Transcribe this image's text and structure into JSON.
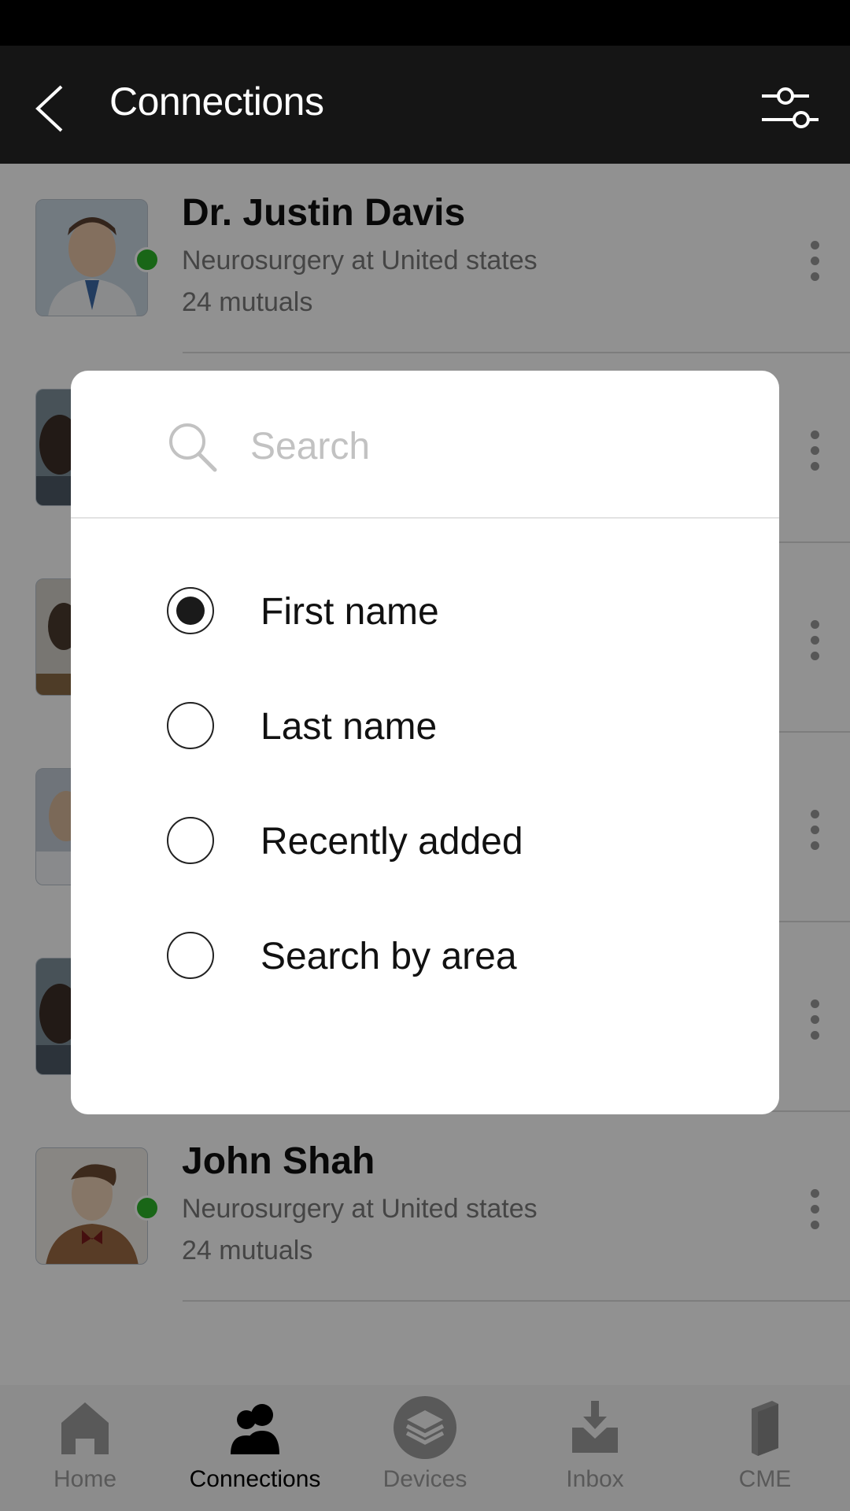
{
  "header": {
    "title": "Connections"
  },
  "contacts": [
    {
      "name": "Dr. Justin Davis",
      "subtitle": "Neurosurgery at United states",
      "mutuals": "24 mutuals",
      "online": true,
      "avatar_color": "#9bb3c7"
    },
    {
      "name": "",
      "subtitle": "",
      "mutuals": "",
      "online": false,
      "avatar_color": "#5c6c78"
    },
    {
      "name": "",
      "subtitle": "",
      "mutuals": "",
      "online": false,
      "avatar_color": "#8c8478"
    },
    {
      "name": "",
      "subtitle": "",
      "mutuals": "",
      "online": false,
      "avatar_color": "#98a7b6"
    },
    {
      "name": "",
      "subtitle": "",
      "mutuals": "",
      "online": false,
      "avatar_color": "#5e6c77"
    },
    {
      "name": "John Shah",
      "subtitle": "Neurosurgery at United states",
      "mutuals": "24 mutuals",
      "online": true,
      "avatar_color": "#b9a48c"
    }
  ],
  "sort_dialog": {
    "search_placeholder": "Search",
    "options": [
      {
        "label": "First name",
        "selected": true
      },
      {
        "label": "Last name",
        "selected": false
      },
      {
        "label": "Recently added",
        "selected": false
      },
      {
        "label": "Search by area",
        "selected": false
      }
    ]
  },
  "bottom_nav": {
    "items": [
      {
        "label": "Home",
        "icon": "home-icon",
        "active": false
      },
      {
        "label": "Connections",
        "icon": "connections-icon",
        "active": true
      },
      {
        "label": "Devices",
        "icon": "devices-icon",
        "active": false
      },
      {
        "label": "Inbox",
        "icon": "inbox-icon",
        "active": false
      },
      {
        "label": "CME",
        "icon": "cme-icon",
        "active": false
      }
    ]
  },
  "colors": {
    "header_bg": "#151515",
    "online": "#2db32a",
    "overlay": "rgba(0,0,0,0.43)",
    "inactive_nav": "#9d9d9d"
  }
}
